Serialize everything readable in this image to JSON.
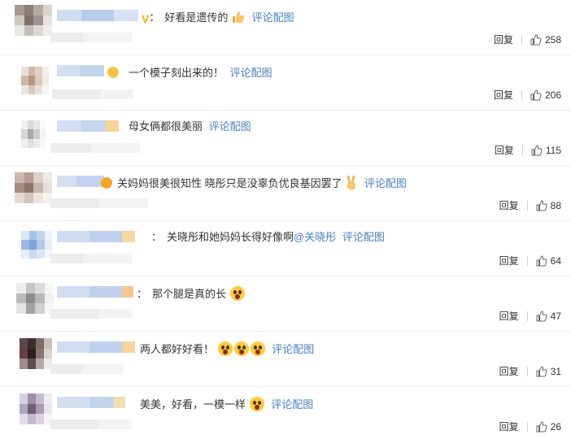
{
  "labels": {
    "reply": "回复",
    "reply_short": "回复",
    "view_image": "评论配图"
  },
  "colors": {
    "link": "#4a7fc1",
    "text": "#333333",
    "divider": "#ececec"
  },
  "comments": [
    {
      "text": "好看是遗传的",
      "emoji": "thumbs-up",
      "has_image_link": true,
      "likes": "258"
    },
    {
      "text": "一个模子刻出来的！",
      "emoji": "",
      "has_image_link": true,
      "likes": "206"
    },
    {
      "text": "母女俩都很美丽",
      "emoji": "",
      "has_image_link": true,
      "likes": "115"
    },
    {
      "text": "关妈妈很美很知性 晓彤只是没辜负优良基因罢了",
      "emoji": "victory-hand",
      "has_image_link": true,
      "likes": "88"
    },
    {
      "text": "关晓彤和她妈妈长得好像啊",
      "mention": "@关晓彤",
      "emoji": "",
      "has_image_link": true,
      "likes": "64"
    },
    {
      "text": "那个腿是真的长",
      "emoji": "shocked-face",
      "has_image_link": false,
      "likes": "47"
    },
    {
      "text": "两人都好好看！",
      "emoji": "shocked-face x3",
      "has_image_link": true,
      "likes": "31"
    },
    {
      "text": "美美，好看，一模一样",
      "emoji": "shocked-face",
      "has_image_link": true,
      "likes": "26"
    }
  ]
}
